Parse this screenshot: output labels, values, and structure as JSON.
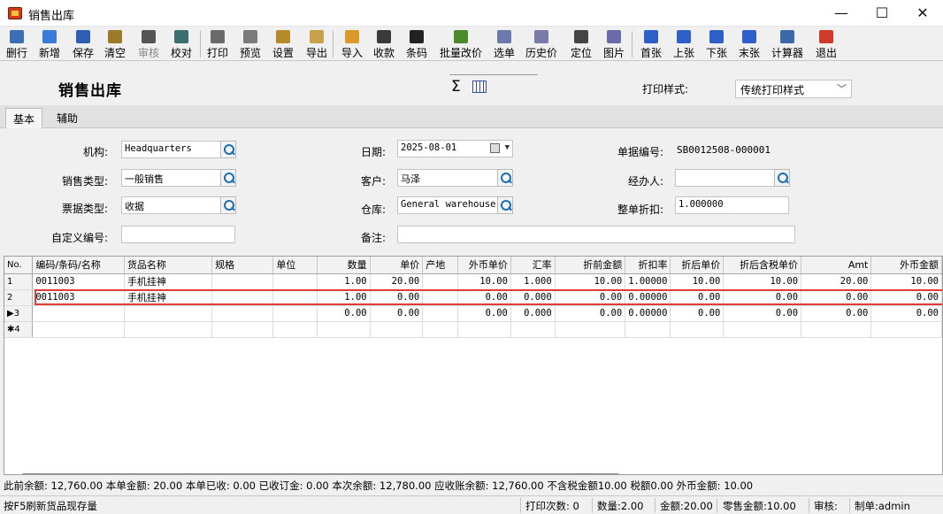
{
  "window": {
    "title": "销售出库"
  },
  "toolbar": [
    {
      "id": "delete-row",
      "label": "删行",
      "icon": "delete-row-icon",
      "color": "#3b6fb5"
    },
    {
      "id": "new",
      "label": "新增",
      "icon": "new-doc-icon",
      "color": "#3b7bd9"
    },
    {
      "id": "save",
      "label": "保存",
      "icon": "save-icon",
      "color": "#2f5fb3"
    },
    {
      "id": "clear",
      "label": "清空",
      "icon": "broom-icon",
      "color": "#9b7b2a"
    },
    {
      "id": "audit",
      "label": "审核",
      "icon": "stamp-icon",
      "color": "#555555",
      "disabled": true
    },
    {
      "id": "verify",
      "label": "校对",
      "icon": "verify-icon",
      "color": "#3b6f6f"
    },
    {
      "id": "print",
      "label": "打印",
      "icon": "printer-icon",
      "color": "#6a6a6a"
    },
    {
      "id": "preview",
      "label": "预览",
      "icon": "preview-icon",
      "color": "#7a7a7a"
    },
    {
      "id": "settings",
      "label": "设置",
      "icon": "settings-icon",
      "color": "#b58a2a"
    },
    {
      "id": "export",
      "label": "导出",
      "icon": "export-icon",
      "color": "#c8a24a"
    },
    {
      "id": "import",
      "label": "导入",
      "icon": "import-icon",
      "color": "#d99a2a"
    },
    {
      "id": "receive",
      "label": "收款",
      "icon": "receive-icon",
      "color": "#3a3a3a"
    },
    {
      "id": "barcode",
      "label": "条码",
      "icon": "barcode-icon",
      "color": "#222222"
    },
    {
      "id": "batch-price",
      "label": "批量改价",
      "icon": "batch-price-icon",
      "color": "#4a8a2a"
    },
    {
      "id": "select-order",
      "label": "选单",
      "icon": "select-order-icon",
      "color": "#6a7aaa"
    },
    {
      "id": "history-price",
      "label": "历史价",
      "icon": "history-icon",
      "color": "#7a7aaa"
    },
    {
      "id": "locate",
      "label": "定位",
      "icon": "binoculars-icon",
      "color": "#444444"
    },
    {
      "id": "picture",
      "label": "图片",
      "icon": "picture-icon",
      "color": "#6a6aaa"
    },
    {
      "id": "first",
      "label": "首张",
      "icon": "first-icon",
      "color": "#2f5fc8"
    },
    {
      "id": "prev",
      "label": "上张",
      "icon": "prev-icon",
      "color": "#2f5fc8"
    },
    {
      "id": "next",
      "label": "下张",
      "icon": "next-icon",
      "color": "#2f5fc8"
    },
    {
      "id": "last",
      "label": "末张",
      "icon": "last-icon",
      "color": "#2f5fc8"
    },
    {
      "id": "calculator",
      "label": "计算器",
      "icon": "calculator-icon",
      "color": "#3a6aaa"
    },
    {
      "id": "exit",
      "label": "退出",
      "icon": "exit-icon",
      "color": "#d03a2a"
    }
  ],
  "header": {
    "title": "销售出库",
    "sigma": "Σ",
    "print_style_label": "打印样式:",
    "print_style_value": "传统打印样式"
  },
  "tabs": [
    "基本",
    "辅助"
  ],
  "form": {
    "org_label": "机构:",
    "org_value": "Headquarters",
    "sale_type_label": "销售类型:",
    "sale_type_value": "一般销售",
    "receipt_type_label": "票据类型:",
    "receipt_type_value": "收据",
    "custom_no_label": "自定义编号:",
    "custom_no_value": "",
    "date_label": "日期:",
    "date_value": "2025-08-01",
    "customer_label": "客户:",
    "customer_value": "马泽",
    "warehouse_label": "仓库:",
    "warehouse_value": "General warehouse",
    "remark_label": "备注:",
    "remark_value": "",
    "doc_no_label": "单据编号:",
    "doc_no_value": "SB0012508-000001",
    "handler_label": "经办人:",
    "handler_value": "",
    "discount_label": "整单折扣:",
    "discount_value": "1.000000"
  },
  "table": {
    "columns": [
      "No.",
      "编码/条码/名称",
      "货品名称",
      "规格",
      "单位",
      "数量",
      "单价",
      "产地",
      "外币单价",
      "汇率",
      "折前金额",
      "折扣率",
      "折后单价",
      "折后含税单价",
      "Amt",
      "外币金额"
    ],
    "rows": [
      [
        "1",
        "0011003",
        "手机挂神",
        "",
        "",
        "1.00",
        "20.00",
        "",
        "10.00",
        "1.000",
        "10.00",
        "1.00000",
        "10.00",
        "10.00",
        "20.00",
        "10.00"
      ],
      [
        "2",
        "0011003",
        "手机挂神",
        "",
        "",
        "1.00",
        "0.00",
        "",
        "0.00",
        "0.000",
        "0.00",
        "0.00000",
        "0.00",
        "0.00",
        "0.00",
        "0.00"
      ],
      [
        "▶3",
        "",
        "",
        "",
        "",
        "0.00",
        "0.00",
        "",
        "0.00",
        "0.000",
        "0.00",
        "0.00000",
        "0.00",
        "0.00",
        "0.00",
        "0.00"
      ],
      [
        "✱4",
        "",
        "",
        "",
        "",
        "",
        "",
        "",
        "",
        "",
        "",
        "",
        "",
        "",
        "",
        ""
      ]
    ]
  },
  "summary": "此前余额: 12,760.00 本单金额: 20.00 本单已收: 0.00 已收订金: 0.00 本次余额: 12,780.00 应收账余额: 12,760.00 不含税金额10.00 税额0.00 外币金额: 10.00",
  "status": {
    "hint": "按F5刷新货品现存量",
    "print_count": "打印次数: 0",
    "quantity": "数量:2.00",
    "amount": "金额:20.00",
    "retail_amount": "零售金额:10.00",
    "auditor": "审核:",
    "creator": "制单:admin"
  }
}
